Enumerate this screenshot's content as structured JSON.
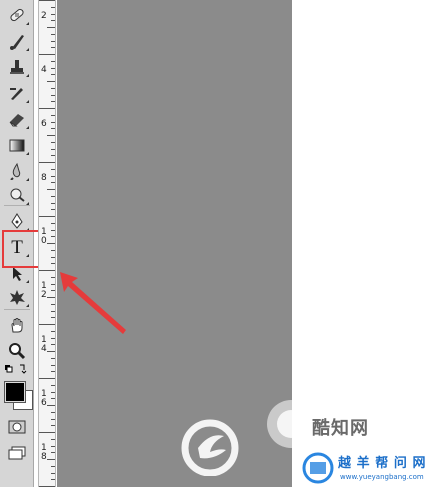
{
  "toolbar": {
    "tools": [
      {
        "name": "healing-brush-tool",
        "icon": "bandage-icon"
      },
      {
        "name": "brush-tool",
        "icon": "brush-icon"
      },
      {
        "name": "clone-stamp-tool",
        "icon": "stamp-icon"
      },
      {
        "name": "history-brush-tool",
        "icon": "history-brush-icon"
      },
      {
        "name": "eraser-tool",
        "icon": "eraser-icon"
      },
      {
        "name": "gradient-tool",
        "icon": "gradient-icon"
      },
      {
        "name": "blur-tool",
        "icon": "drop-icon"
      },
      {
        "name": "dodge-tool",
        "icon": "dodge-icon"
      },
      {
        "name": "pen-tool",
        "icon": "pen-icon"
      },
      {
        "name": "type-tool",
        "icon": "type-icon",
        "glyph": "T"
      },
      {
        "name": "path-selection-tool",
        "icon": "arrow-cursor-icon"
      },
      {
        "name": "custom-shape-tool",
        "icon": "shape-icon"
      },
      {
        "name": "hand-tool",
        "icon": "hand-icon"
      },
      {
        "name": "zoom-tool",
        "icon": "magnifier-icon"
      }
    ],
    "foreground_color": "#000000",
    "background_color": "#ffffff",
    "highlight_color": "#e53b3b"
  },
  "ruler": {
    "labels": [
      "2",
      "4",
      "6",
      "8",
      "1 0",
      "1 2",
      "1 4",
      "1 6",
      "1 8"
    ]
  },
  "canvas": {
    "color": "#8b8b8b"
  },
  "watermarks": {
    "site1": "酷知网",
    "site2_title": "越 羊 帮 问 网",
    "site2_url": "www.yueyangbang.com"
  }
}
